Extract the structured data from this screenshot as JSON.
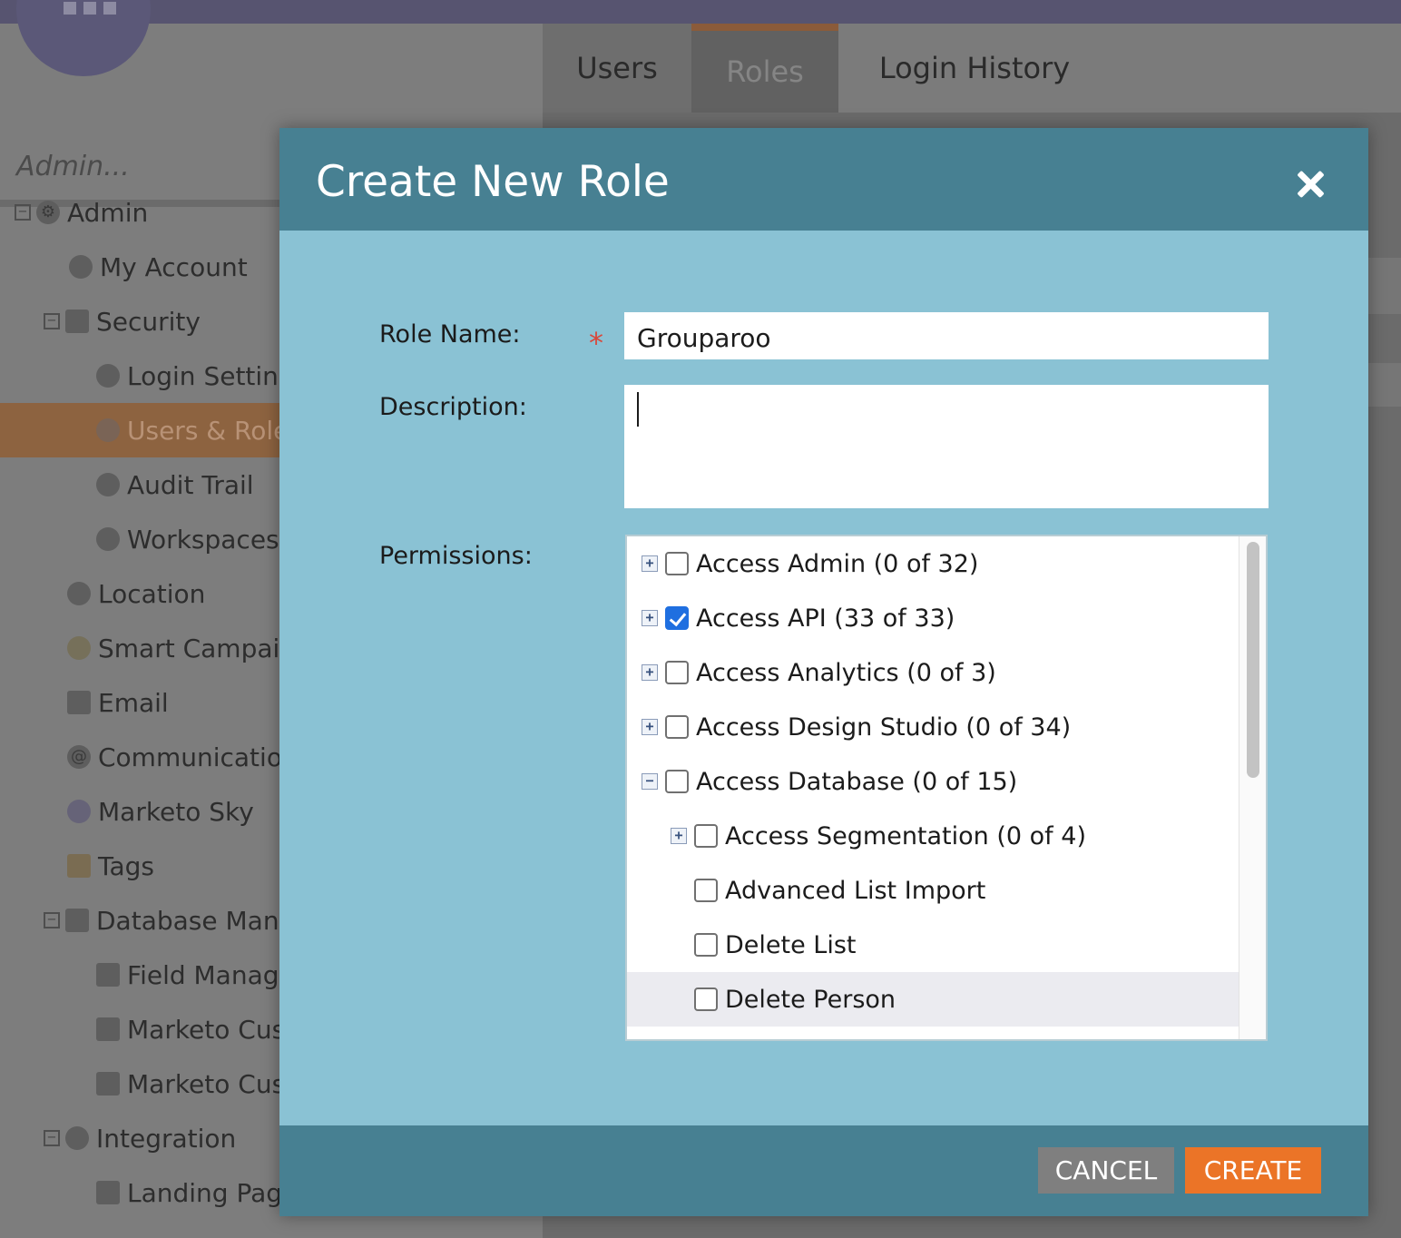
{
  "app": {
    "search_placeholder": "Admin...",
    "tabs": [
      {
        "label": "Users"
      },
      {
        "label": "Roles"
      },
      {
        "label": "Login History"
      }
    ],
    "sidebar": {
      "items": [
        {
          "label": "Admin",
          "icon": "gear-icon"
        },
        {
          "label": "My Account",
          "icon": "user-icon"
        },
        {
          "label": "Security",
          "icon": "lock-icon"
        },
        {
          "label": "Login Settings",
          "icon": "key-icon"
        },
        {
          "label": "Users & Roles",
          "icon": "users-icon"
        },
        {
          "label": "Audit Trail",
          "icon": "audit-icon"
        },
        {
          "label": "Workspaces",
          "icon": "globe-icon"
        },
        {
          "label": "Location",
          "icon": "location-icon"
        },
        {
          "label": "Smart Campaign",
          "icon": "lightbulb-icon"
        },
        {
          "label": "Email",
          "icon": "email-icon"
        },
        {
          "label": "Communication",
          "icon": "at-icon"
        },
        {
          "label": "Marketo Sky",
          "icon": "bird-icon"
        },
        {
          "label": "Tags",
          "icon": "tag-icon"
        },
        {
          "label": "Database Management",
          "icon": "database-icon"
        },
        {
          "label": "Field Management",
          "icon": "database-icon"
        },
        {
          "label": "Marketo Custom",
          "icon": "grid-icon"
        },
        {
          "label": "Marketo Custom",
          "icon": "grid-icon"
        },
        {
          "label": "Integration",
          "icon": "cloud-icon"
        },
        {
          "label": "Landing Pages",
          "icon": "page-icon"
        }
      ]
    }
  },
  "dialog": {
    "title": "Create New Role",
    "role_name_label": "Role Name:",
    "required_marker": "*",
    "role_name_value": "Grouparoo",
    "description_label": "Description:",
    "description_value": "",
    "permissions_label": "Permissions:",
    "permissions": [
      {
        "label": "Access Admin (0 of 32)",
        "checked": false,
        "toggle": "+",
        "level": 0
      },
      {
        "label": "Access API (33 of 33)",
        "checked": true,
        "toggle": "+",
        "level": 0
      },
      {
        "label": "Access Analytics (0 of 3)",
        "checked": false,
        "toggle": "+",
        "level": 0
      },
      {
        "label": "Access Design Studio (0 of 34)",
        "checked": false,
        "toggle": "+",
        "level": 0
      },
      {
        "label": "Access Database (0 of 15)",
        "checked": false,
        "toggle": "−",
        "level": 0
      },
      {
        "label": "Access Segmentation (0 of 4)",
        "checked": false,
        "toggle": "+",
        "level": 1
      },
      {
        "label": "Advanced List Import",
        "checked": false,
        "toggle": "",
        "level": 1
      },
      {
        "label": "Delete List",
        "checked": false,
        "toggle": "",
        "level": 1
      },
      {
        "label": "Delete Person",
        "checked": false,
        "toggle": "",
        "level": 1
      }
    ],
    "cancel_label": "CANCEL",
    "create_label": "CREATE",
    "colors": {
      "header": "#478092",
      "body": "#8ac2d4",
      "create": "#eb7427",
      "cancel": "#7f7f7f",
      "checkbox_checked": "#1f6fe0"
    }
  }
}
